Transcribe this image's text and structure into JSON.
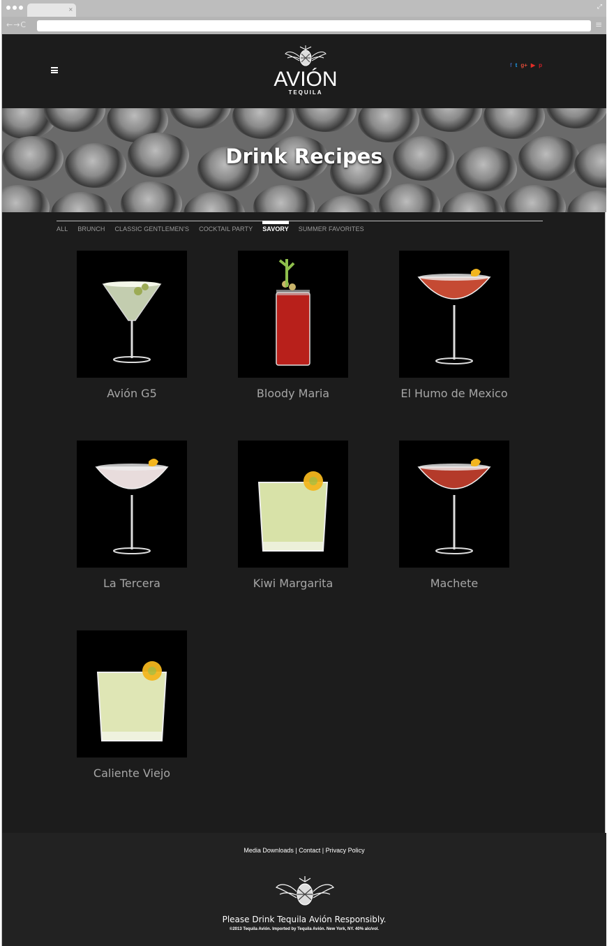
{
  "browser": {
    "tab_close": "×",
    "nav_glyphs": "←→C",
    "menu_glyph": "≡"
  },
  "header": {
    "logo_word": "AVIÓN",
    "logo_sub": "TEQUILA",
    "social": [
      {
        "icon": "facebook-icon",
        "glyph": "f",
        "color": "#3b5998"
      },
      {
        "icon": "twitter-icon",
        "glyph": "t",
        "color": "#1da1f2"
      },
      {
        "icon": "google-plus-icon",
        "glyph": "g+",
        "color": "#dd4b39"
      },
      {
        "icon": "youtube-icon",
        "glyph": "▶",
        "color": "#e52d27"
      },
      {
        "icon": "pinterest-icon",
        "glyph": "p",
        "color": "#cb2027"
      }
    ]
  },
  "hero": {
    "title": "Drink Recipes"
  },
  "filters": {
    "items": [
      "ALL",
      "BRUNCH",
      "CLASSIC GENTLEMEN'S",
      "COCKTAIL PARTY",
      "SAVORY",
      "SUMMER FAVORITES"
    ],
    "active": "SAVORY"
  },
  "recipes": [
    {
      "name": "Avión G5",
      "glass": "martini",
      "drink_color": "#d9e4c2"
    },
    {
      "name": "Bloody Maria",
      "glass": "highball",
      "drink_color": "#b8201b"
    },
    {
      "name": "El Humo de Mexico",
      "glass": "coupe",
      "drink_color": "#c54a33"
    },
    {
      "name": "La Tercera",
      "glass": "coupe",
      "drink_color": "#e8dcdc"
    },
    {
      "name": "Kiwi Margarita",
      "glass": "rocks",
      "drink_color": "#d8e2a8"
    },
    {
      "name": "Machete",
      "glass": "coupe",
      "drink_color": "#b43a2a"
    },
    {
      "name": "Caliente Viejo",
      "glass": "rocks",
      "drink_color": "#dfe6b5"
    }
  ],
  "footer": {
    "links": [
      "Media Downloads",
      "Contact",
      "Privacy Policy"
    ],
    "separator": " | ",
    "message": "Please Drink Tequila Avión Responsibly.",
    "copyright": "©2013 Tequila Avión. Imported by Tequila Avión. New York, NY. 40% alc/vol."
  }
}
